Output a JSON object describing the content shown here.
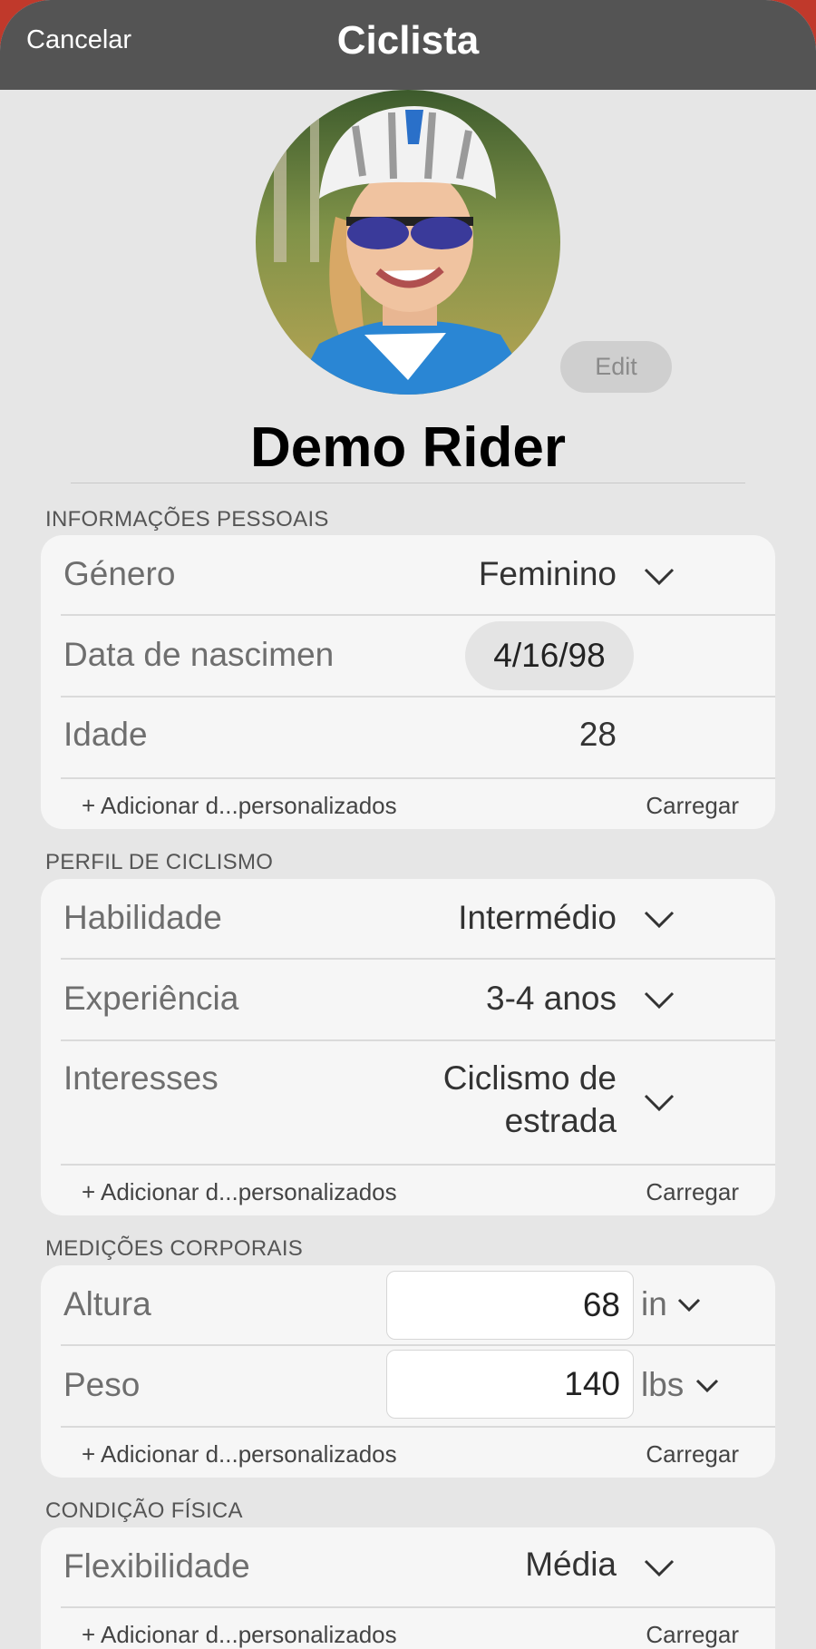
{
  "navbar": {
    "cancel": "Cancelar",
    "title": "Ciclista"
  },
  "profile": {
    "edit": "Edit",
    "name": "Demo Rider"
  },
  "personal": {
    "header": "INFORMAÇÕES PESSOAIS",
    "gender_label": "Género",
    "gender_value": "Feminino",
    "birth_label": "Data de nascimen",
    "birth_value": "4/16/98",
    "age_label": "Idade",
    "age_value": "28",
    "add_custom": "+ Adicionar d...personalizados",
    "load": "Carregar"
  },
  "cycling": {
    "header": "PERFIL DE CICLISMO",
    "skill_label": "Habilidade",
    "skill_value": "Intermédio",
    "experience_label": "Experiência",
    "experience_value": "3-4 anos",
    "interests_label": "Interesses",
    "interests_value_line1": "Ciclismo de",
    "interests_value_line2": "estrada",
    "add_custom": "+ Adicionar d...personalizados",
    "load": "Carregar"
  },
  "body": {
    "header": "MEDIÇÕES CORPORAIS",
    "height_label": "Altura",
    "height_value": "68",
    "height_unit": "in",
    "weight_label": "Peso",
    "weight_value": "140",
    "weight_unit": "lbs",
    "add_custom": "+ Adicionar d...personalizados",
    "load": "Carregar"
  },
  "fitness": {
    "header": "CONDIÇÃO FÍSICA",
    "flex_label": "Flexibilidade",
    "flex_value": "Média",
    "add_custom": "+ Adicionar d...personalizados",
    "load": "Carregar"
  },
  "icons": {
    "dropdown": "chevron-down-icon",
    "avatar": "rider-photo"
  }
}
